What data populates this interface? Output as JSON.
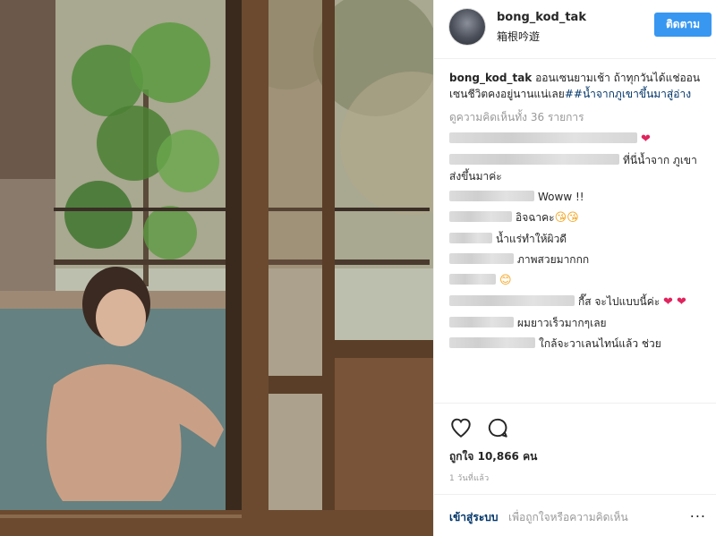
{
  "post": {
    "username": "bong_kod_tak",
    "location": "箱根吟遊",
    "follow_label": "ติดตาม",
    "caption_user": "bong_kod_tak",
    "caption_text": " ออนเซนยามเช้า ถ้าทุกวันได้แช่ออนเซนชีวิตคงอยู่นานแน่เลย",
    "caption_hashtag": "##น้ำจากภูเขาขึ้นมาสู่อ่าง",
    "view_all_comments": "ดูความคิดเห็นทั้ง 36 รายการ",
    "comments": [
      {
        "text": "",
        "emoji": "❤"
      },
      {
        "text": "ที่นี่น้ำจาก ภูเขา ส่งขึ้นมาค่ะ",
        "emoji": ""
      },
      {
        "text": "Woww !!",
        "emoji": ""
      },
      {
        "text": "อิจฉาคะ",
        "emoji": "😘😘"
      },
      {
        "text": "น้ำแร่ทำให้ผิวดี",
        "emoji": ""
      },
      {
        "text": "ภาพสวยมากกก",
        "emoji": ""
      },
      {
        "text": "",
        "emoji": "😊"
      },
      {
        "text": "กี๊ส จะไปแบบนี้ค่ะ",
        "emoji": "❤ ❤"
      },
      {
        "text": "ผมยาวเร็วมากๆเลย",
        "emoji": ""
      },
      {
        "text": "ใกล้จะวาเลนไทน์แล้ว ช่วย",
        "emoji": ""
      }
    ],
    "likes": "ถูกใจ 10,866 คน",
    "time_ago": "1 วันที่แล้ว",
    "login_link": "เข้าสู่ระบบ",
    "login_prompt": "เพื่อถูกใจหรือความคิดเห็น",
    "more_options": "..."
  },
  "colors": {
    "accent": "#3897f0",
    "link": "#003569",
    "muted": "#999999",
    "heart": "#e0245e"
  }
}
